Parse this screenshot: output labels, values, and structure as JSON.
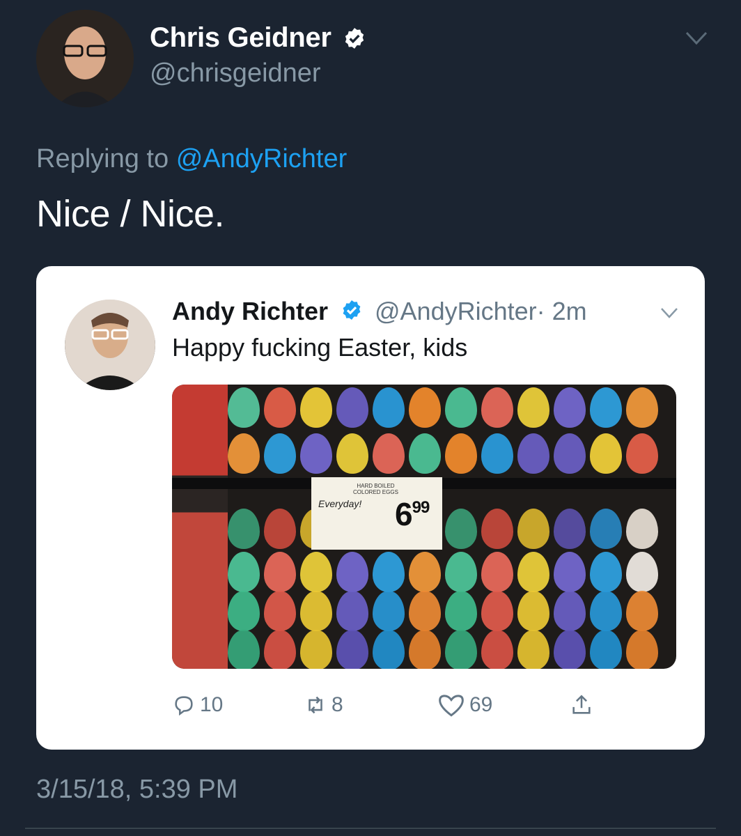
{
  "tweet": {
    "author_name": "Chris Geidner",
    "author_handle": "@chrisgeidner",
    "replying_label": "Replying to",
    "replying_handle": "@AndyRichter",
    "text": "Nice / Nice.",
    "timestamp": "3/15/18, 5:39 PM"
  },
  "quoted": {
    "author_name": "Andy Richter",
    "author_handle": "@AndyRichter",
    "age": "· 2m",
    "text": "Happy fucking Easter, kids",
    "image": {
      "tag_small_text": "HARD BOILED\nCOLORED EGGS",
      "tag_everyday": "Everyday!",
      "tag_price_main": "6",
      "tag_price_cents": "99"
    },
    "actions": {
      "replies": "10",
      "retweets": "8",
      "likes": "69"
    }
  },
  "colors": {
    "background": "#1b2431",
    "accent": "#1da1f2",
    "muted": "#8899a6"
  },
  "icons": [
    "verified-badge-icon",
    "chevron-down-icon",
    "reply-icon",
    "retweet-icon",
    "like-icon",
    "share-icon"
  ]
}
